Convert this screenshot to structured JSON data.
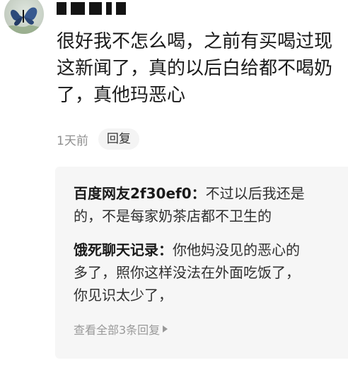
{
  "comment": {
    "username": "",
    "text_lines": [
      "很好我不怎么喝，之前有买喝过现",
      "这新闻了，真的以后白给都不喝奶",
      "了，真他玛恶心"
    ],
    "time": "1天前",
    "reply_label": "回复"
  },
  "replies": {
    "items": [
      {
        "author": "百度网友2f30ef0",
        "separator": "：",
        "lines": [
          "不过以后我还是",
          "的，不是每家奶茶店都不卫生的"
        ]
      },
      {
        "author": "饿死聊天记录",
        "separator": "：",
        "lines": [
          "你他妈没见的恶心的",
          "多了，照你这样没法在外面吃饭了，",
          "你见识太少了，"
        ]
      }
    ],
    "view_all": "查看全部3条回复"
  },
  "colors": {
    "text": "#1a1a1a",
    "meta": "#8f8f8f",
    "reply_bg": "#f6f6f6"
  }
}
